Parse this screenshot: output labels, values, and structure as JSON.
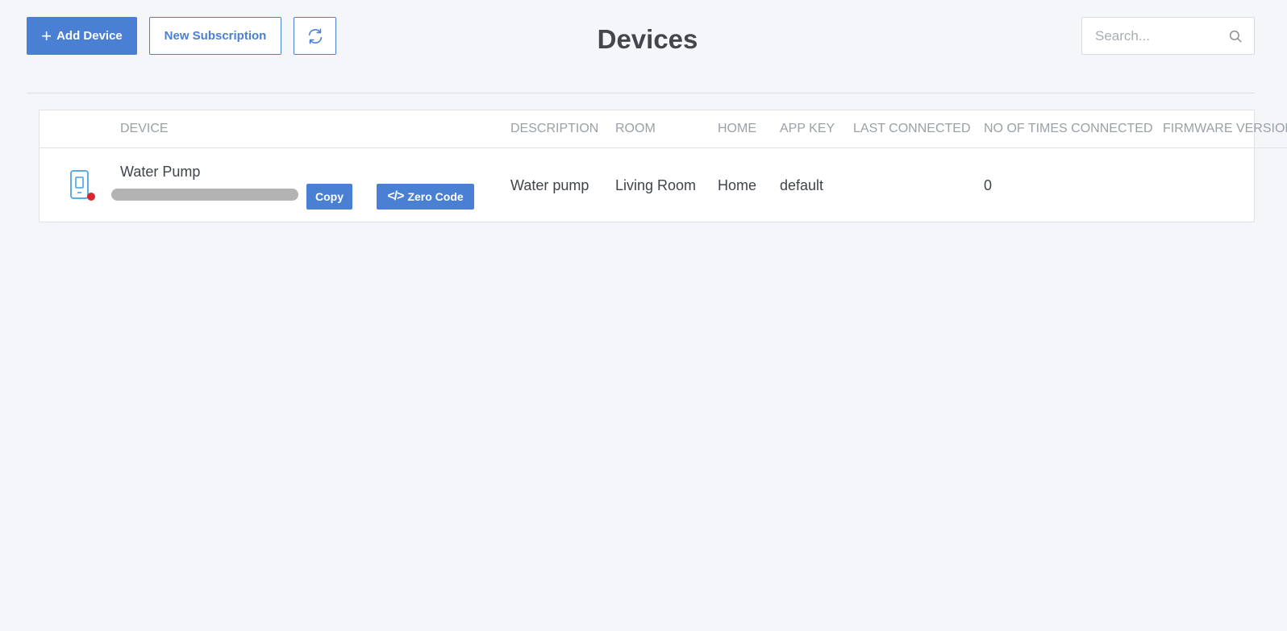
{
  "toolbar": {
    "add_device_icon": "+",
    "add_device_label": "Add Device",
    "new_subscription_label": "New Subscription",
    "refresh_icon": "refresh-icon"
  },
  "page": {
    "title": "Devices"
  },
  "search": {
    "placeholder": "Search...",
    "value": "",
    "icon": "search-icon"
  },
  "table": {
    "columns": [
      "DEVICE",
      "DESCRIPTION",
      "ROOM",
      "HOME",
      "APP KEY",
      "LAST CONNECTED",
      "NO OF TIMES CONNECTED",
      "FIRMWARE VERSION"
    ],
    "rows": [
      {
        "icon": "phone-device-icon",
        "status": "offline",
        "status_color": "#d9262c",
        "name": "Water Pump",
        "copy_label": "Copy",
        "zero_code_icon": "</>",
        "zero_code_label": "Zero Code",
        "description": "Water pump",
        "room": "Living Room",
        "home": "Home",
        "app_key": "default",
        "last_connected": "",
        "times_connected": "0",
        "firmware_version": ""
      }
    ]
  },
  "colors": {
    "accent": "#4a80d4",
    "background": "#f4f6fa",
    "device_icon": "#5aaee8"
  }
}
